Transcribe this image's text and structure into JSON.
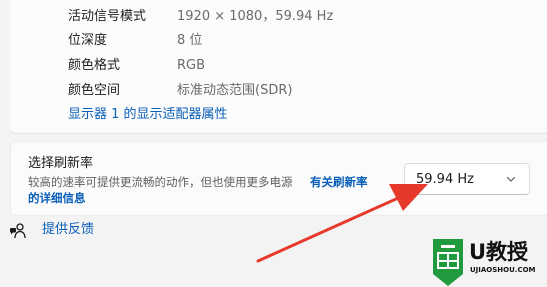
{
  "display_info": {
    "rows": [
      {
        "label": "活动信号模式",
        "value": "1920 × 1080，59.94 Hz"
      },
      {
        "label": "位深度",
        "value": "8 位"
      },
      {
        "label": "颜色格式",
        "value": "RGB"
      },
      {
        "label": "颜色空间",
        "value": "标准动态范围(SDR)"
      }
    ],
    "adapter_link": "显示器 1 的显示适配器属性"
  },
  "refresh_rate": {
    "title": "选择刷新率",
    "description": "较高的速率可提供更流畅的动作，但也使用更多电源",
    "link_line1": "有关刷新率",
    "link_line2": "的详细信息",
    "selected_value": "59.94 Hz"
  },
  "feedback": {
    "label": "提供反馈",
    "icon": "feedback-icon"
  },
  "watermark": {
    "brand": "U教授",
    "domain": "UJIAOSHOU.COM"
  },
  "colors": {
    "accent": "#0a5fb8",
    "annotation_arrow": "#e6392c",
    "logo_green": "#1f9a3c"
  }
}
